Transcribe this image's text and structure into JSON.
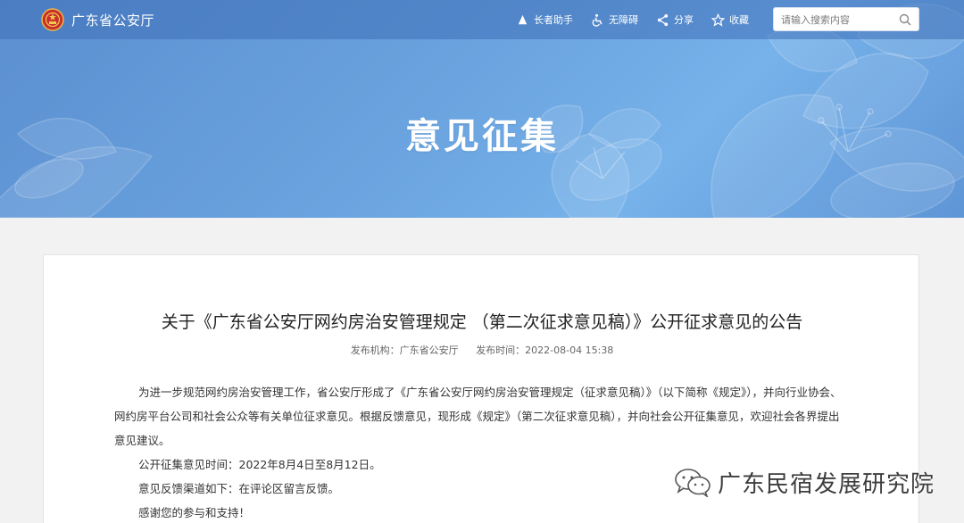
{
  "header": {
    "site_name": "广东省公安厅",
    "tools": [
      {
        "label": "长者助手",
        "icon": "elder-icon"
      },
      {
        "label": "无障碍",
        "icon": "accessibility-icon"
      },
      {
        "label": "分享",
        "icon": "share-icon"
      },
      {
        "label": "收藏",
        "icon": "star-icon"
      }
    ],
    "search_placeholder": "请输入搜索内容"
  },
  "banner": {
    "title": "意见征集"
  },
  "article": {
    "title": "关于《广东省公安厅网约房治安管理规定 （第二次征求意见稿）》公开征求意见的公告",
    "publisher_label": "发布机构：广东省公安厅",
    "time_label": "发布时间：2022-08-04 15:38",
    "paragraphs": [
      "为进一步规范网约房治安管理工作，省公安厅形成了《广东省公安厅网约房治安管理规定（征求意见稿）》（以下简称《规定》），并向行业协会、网约房平台公司和社会公众等有关单位征求意见。根据反馈意见，现形成《规定》（第二次征求意见稿），并向社会公开征集意见，欢迎社会各界提出意见建议。",
      "公开征集意见时间：2022年8月4日至8月12日。",
      "意见反馈渠道如下：在评论区留言反馈。",
      "感谢您的参与和支持！"
    ]
  },
  "watermark": {
    "text": "广东民宿发展研究院",
    "icon": "wechat-icon"
  },
  "colors": {
    "banner": "#6aa3df",
    "topbar": "#3e70b8",
    "text": "#333333"
  }
}
